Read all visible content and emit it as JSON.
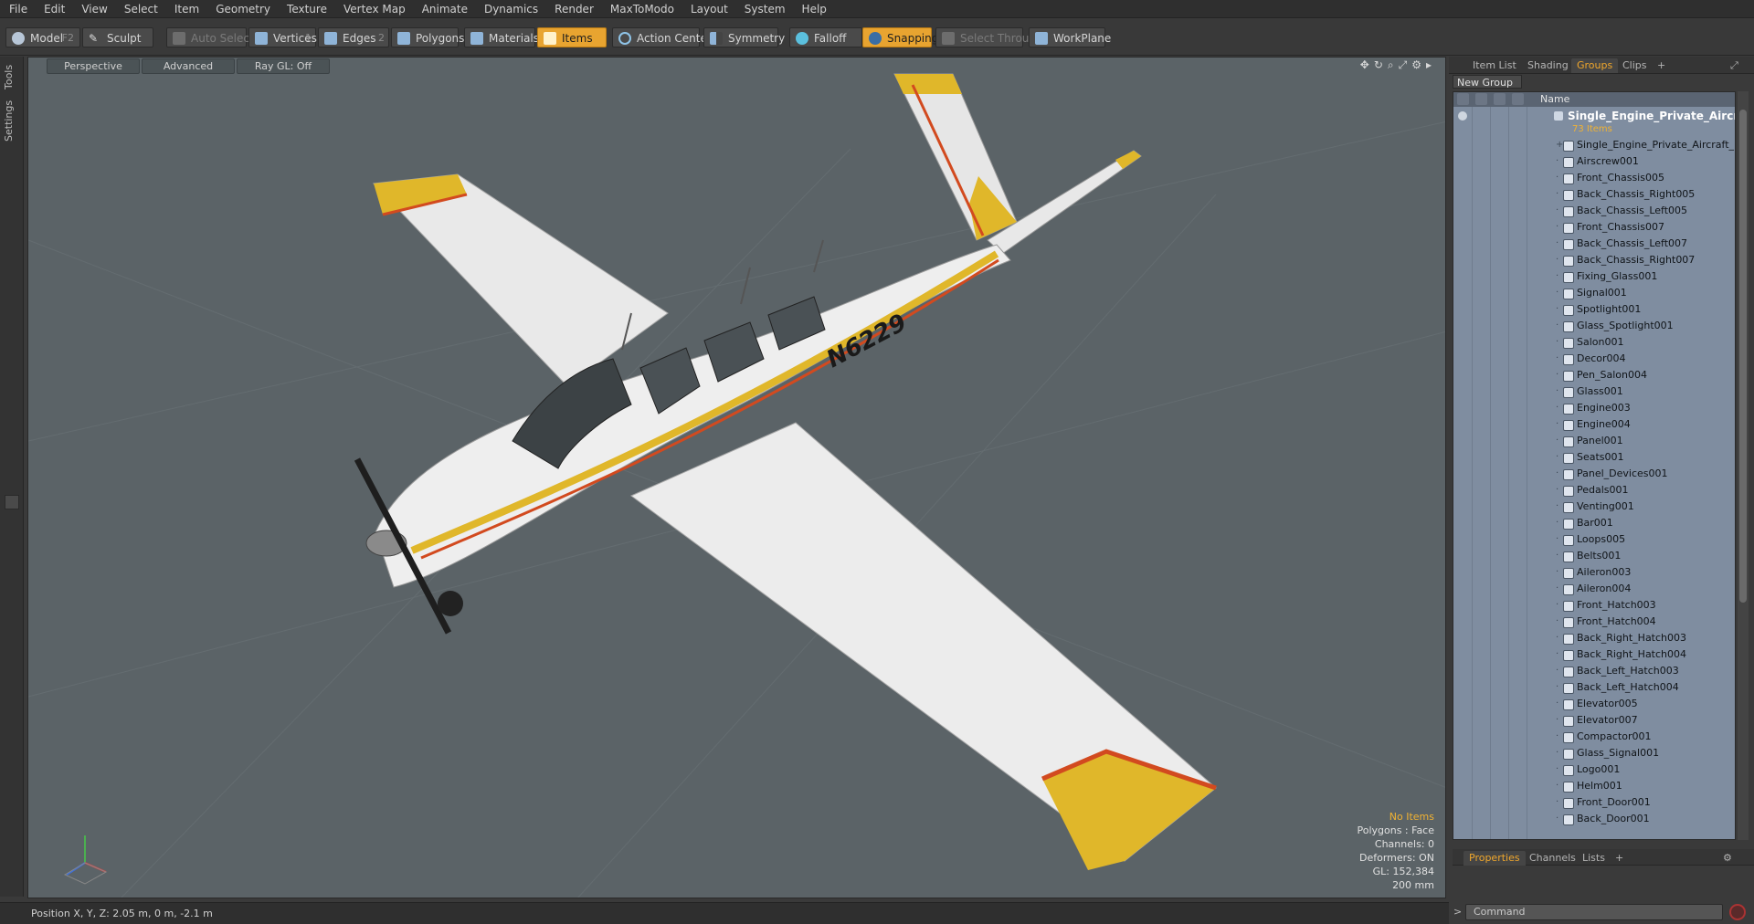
{
  "menu": [
    "File",
    "Edit",
    "View",
    "Select",
    "Item",
    "Geometry",
    "Texture",
    "Vertex Map",
    "Animate",
    "Dynamics",
    "Render",
    "MaxToModo",
    "Layout",
    "System",
    "Help"
  ],
  "toolbar": {
    "model": "Model",
    "model_key": "F2",
    "sculpt": "Sculpt",
    "auto_select": "Auto Select",
    "vertices": "Vertices",
    "vertices_key": "1",
    "edges": "Edges",
    "edges_key": "2",
    "polygons": "Polygons",
    "materials": "Materials",
    "items": "Items",
    "action_center": "Action Center",
    "symmetry": "Symmetry",
    "falloff": "Falloff",
    "snapping": "Snapping",
    "select_through": "Select Through",
    "workplane": "WorkPlane"
  },
  "left_tabs": [
    "Tools",
    "Settings"
  ],
  "viewport": {
    "mode": "Perspective",
    "shading": "Advanced",
    "raygl": "Ray GL: Off",
    "aircraft_reg": "N6229",
    "stats": {
      "selection": "No Items",
      "polygons": "Polygons : Face",
      "channels": "Channels: 0",
      "deformers": "Deformers: ON",
      "gl": "GL: 152,384",
      "scale": "200 mm"
    }
  },
  "status": {
    "position": "Position X, Y, Z:  2.05 m, 0 m, -2.1 m"
  },
  "right_panel": {
    "tabs": [
      "Item List",
      "Shading",
      "Groups",
      "Clips"
    ],
    "active_tab": "Groups",
    "new_group": "New Group",
    "col_name": "Name",
    "root": "Single_Engine_Private_Aircraf ...",
    "root_count": "73 Items",
    "items": [
      "Single_Engine_Private_Aircraft_B ...",
      "Airscrew001",
      "Front_Chassis005",
      "Back_Chassis_Right005",
      "Back_Chassis_Left005",
      "Front_Chassis007",
      "Back_Chassis_Left007",
      "Back_Chassis_Right007",
      "Fixing_Glass001",
      "Signal001",
      "Spotlight001",
      "Glass_Spotlight001",
      "Salon001",
      "Decor004",
      "Pen_Salon004",
      "Glass001",
      "Engine003",
      "Engine004",
      "Panel001",
      "Seats001",
      "Panel_Devices001",
      "Pedals001",
      "Venting001",
      "Bar001",
      "Loops005",
      "Belts001",
      "Aileron003",
      "Aileron004",
      "Front_Hatch003",
      "Front_Hatch004",
      "Back_Right_Hatch003",
      "Back_Right_Hatch004",
      "Back_Left_Hatch003",
      "Back_Left_Hatch004",
      "Elevator005",
      "Elevator007",
      "Compactor001",
      "Glass_Signal001",
      "Logo001",
      "Helm001",
      "Front_Door001",
      "Back_Door001"
    ],
    "bottom_tabs": [
      "Properties",
      "Channels",
      "Lists"
    ],
    "bottom_active": "Properties",
    "command_placeholder": "Command"
  },
  "colors": {
    "accent": "#e8a430",
    "viewport_bg": "#5b6367",
    "list_bg": "#7f8da0"
  }
}
